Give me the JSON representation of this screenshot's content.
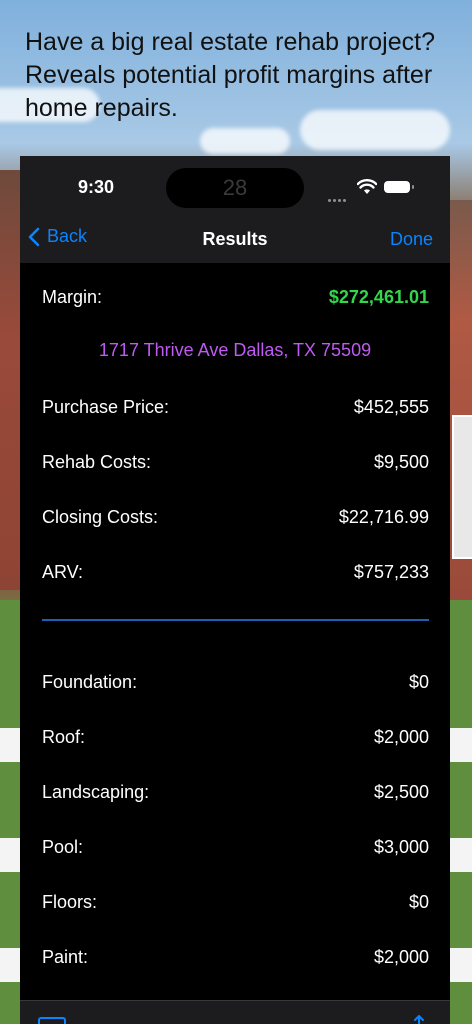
{
  "headline": "Have a big real estate rehab project? Reveals potential profit margins after home repairs.",
  "status_bar": {
    "time": "9:30",
    "island_number": "28"
  },
  "nav": {
    "back_label": "Back",
    "title": "Results",
    "done_label": "Done"
  },
  "colors": {
    "accent": "#0a84ff",
    "margin_value": "#32d74b",
    "address": "#bf5af2",
    "divider": "#1f5fb3"
  },
  "summary": {
    "margin_label": "Margin:",
    "margin_value": "$272,461.01",
    "address": "1717 Thrive Ave Dallas, TX 75509",
    "rows": [
      {
        "label": "Purchase Price:",
        "value": "$452,555"
      },
      {
        "label": "Rehab Costs:",
        "value": "$9,500"
      },
      {
        "label": "Closing Costs:",
        "value": "$22,716.99"
      },
      {
        "label": "ARV:",
        "value": "$757,233"
      }
    ]
  },
  "repairs": [
    {
      "label": "Foundation:",
      "value": "$0"
    },
    {
      "label": "Roof:",
      "value": "$2,000"
    },
    {
      "label": "Landscaping:",
      "value": "$2,500"
    },
    {
      "label": "Pool:",
      "value": "$3,000"
    },
    {
      "label": "Floors:",
      "value": "$0"
    },
    {
      "label": "Paint:",
      "value": "$2,000"
    }
  ],
  "toolbar": {
    "left_icon": "tray-icon",
    "right_icon": "share-icon"
  }
}
